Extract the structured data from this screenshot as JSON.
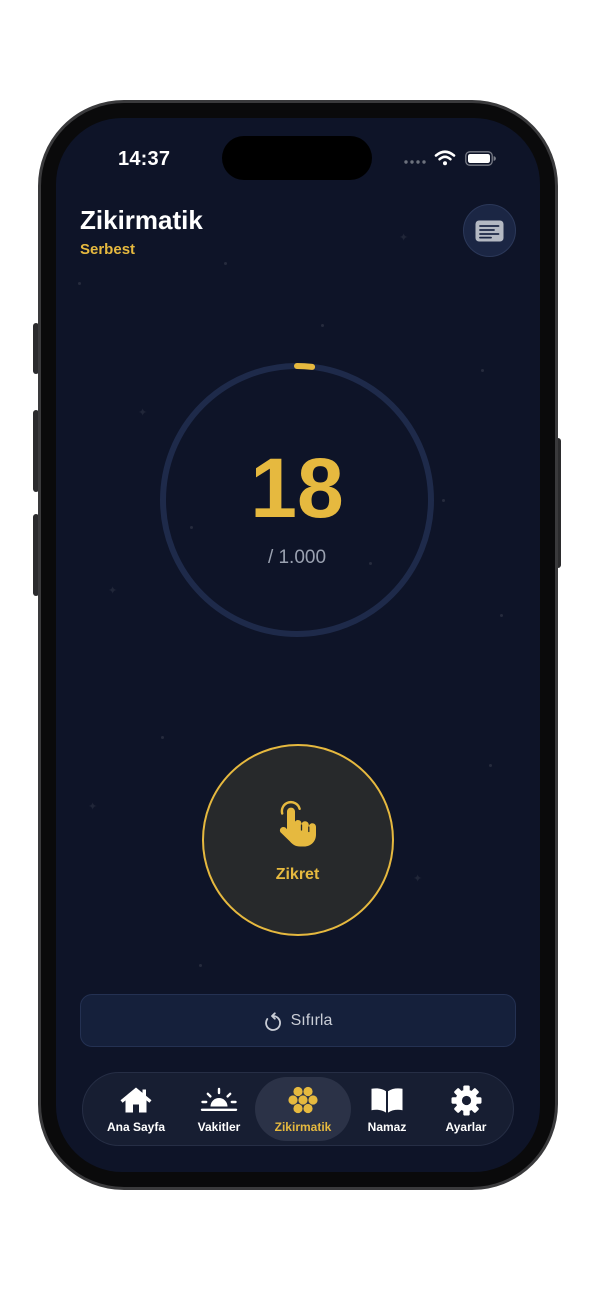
{
  "status_bar": {
    "time": "14:37",
    "signal_icon": "signal-dots-icon",
    "wifi_icon": "wifi-icon",
    "battery_icon": "battery-icon",
    "battery_level": 1.0
  },
  "header": {
    "title": "Zikirmatik",
    "subtitle": "Serbest",
    "list_button_icon": "list-icon"
  },
  "counter": {
    "count": 18,
    "target_label": "/ 1.000",
    "progress": 0.018
  },
  "tap_button": {
    "label": "Zikret",
    "icon": "hand-tap-icon"
  },
  "reset_button": {
    "label": "Sıfırla",
    "icon": "reset-icon"
  },
  "tab_bar": {
    "items": [
      {
        "label": "Ana Sayfa",
        "icon": "house-icon",
        "active": false
      },
      {
        "label": "Vakitler",
        "icon": "sunrise-icon",
        "active": false
      },
      {
        "label": "Zikirmatik",
        "icon": "beads-icon",
        "active": true
      },
      {
        "label": "Namaz",
        "icon": "book-icon",
        "active": false
      },
      {
        "label": "Ayarlar",
        "icon": "gear-icon",
        "active": false
      }
    ]
  },
  "colors": {
    "background": "#0e1428",
    "accent": "#e6b93f",
    "ring_track": "#1e2a4a",
    "text_primary": "#ffffff",
    "text_secondary": "#9aa1b0",
    "tap_button_fill": "#27292b",
    "panel": "#15203b",
    "tab_bar": "#171e32",
    "tab_active": "#2b3247"
  }
}
